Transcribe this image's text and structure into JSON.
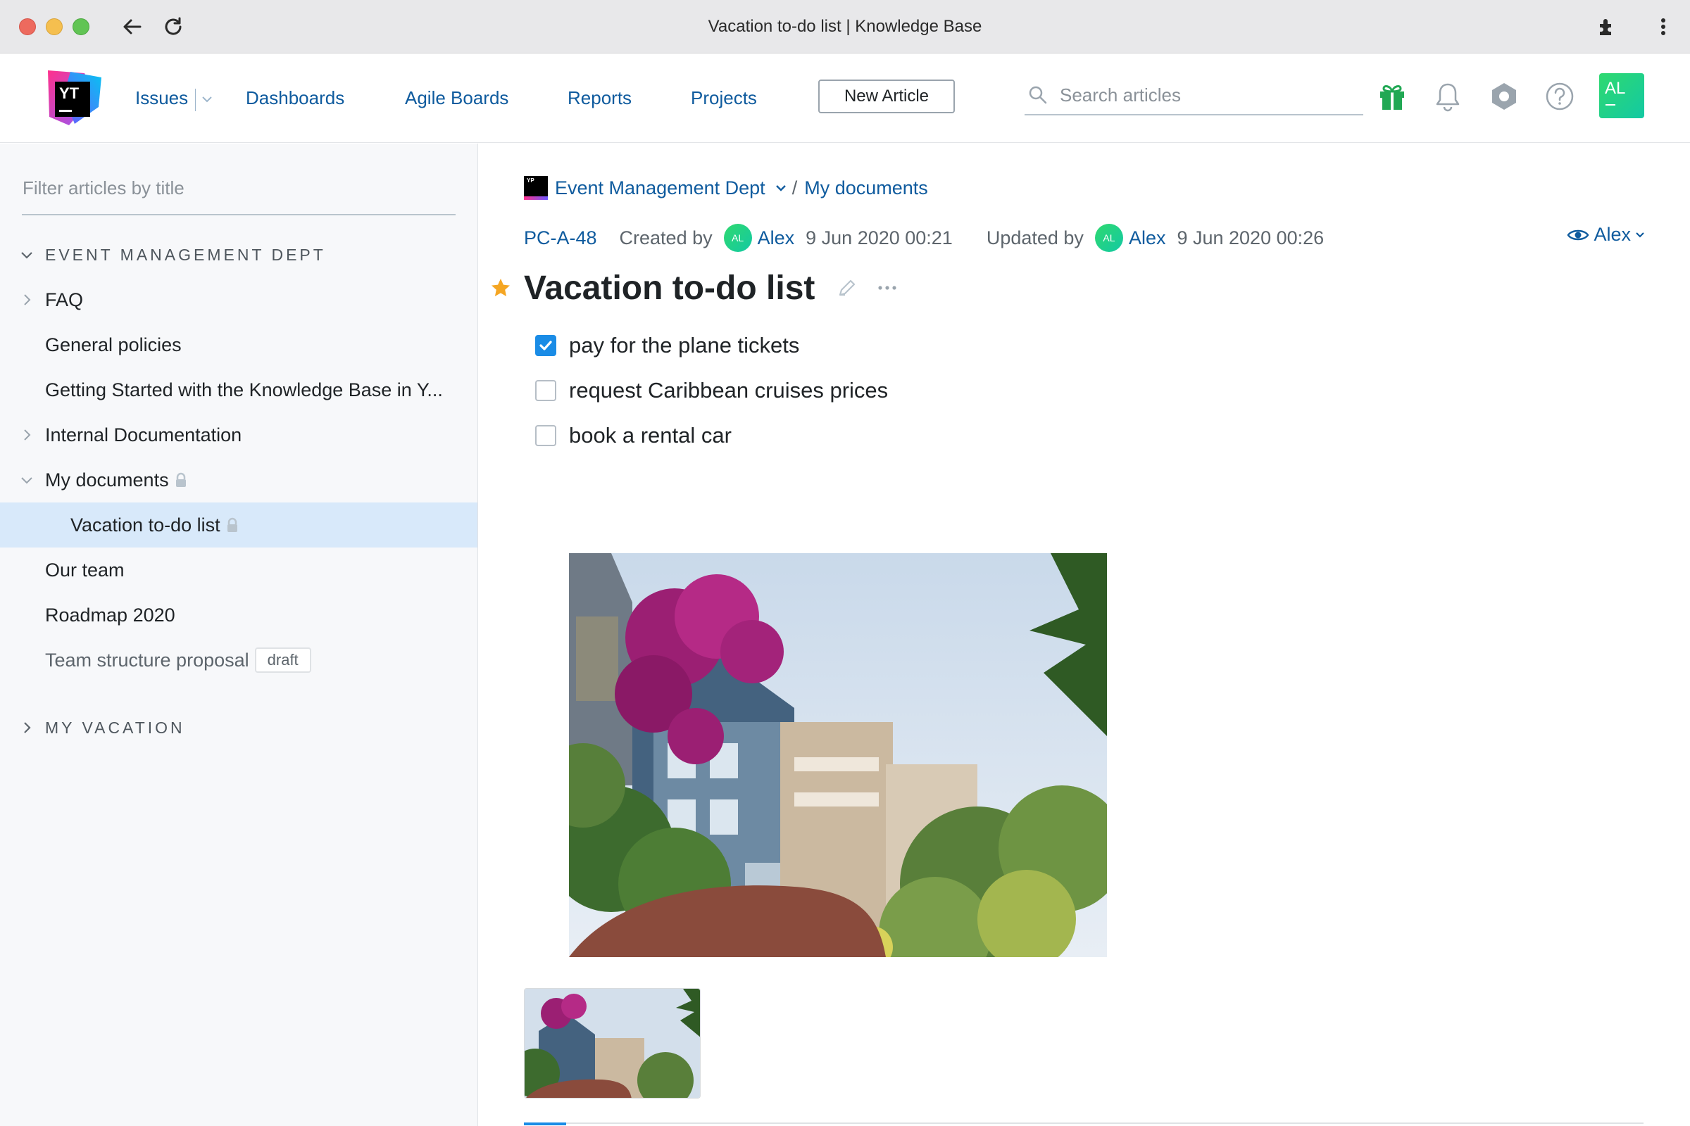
{
  "browser": {
    "tab_title": "Vacation to-do list | Knowledge Base"
  },
  "header": {
    "logo_text": "YT",
    "nav": {
      "issues": "Issues",
      "dashboards": "Dashboards",
      "agile_boards": "Agile Boards",
      "reports": "Reports",
      "projects": "Projects"
    },
    "new_article_label": "New Article",
    "search_placeholder": "Search articles",
    "icons": [
      "gift-icon",
      "bell-icon",
      "settings-icon",
      "help-icon"
    ],
    "avatar_initials": "AL"
  },
  "sidebar": {
    "filter_placeholder": "Filter articles by title",
    "section_1": "EVENT MANAGEMENT DEPT",
    "items": [
      {
        "label": "FAQ"
      },
      {
        "label": "General policies"
      },
      {
        "label": "Getting Started with the Knowledge Base in Y..."
      },
      {
        "label": "Internal Documentation"
      },
      {
        "label": "My documents"
      },
      {
        "label": "Vacation to-do list"
      },
      {
        "label": "Our team"
      },
      {
        "label": "Roadmap 2020"
      },
      {
        "label": "Team structure proposal",
        "badge": "draft"
      }
    ],
    "section_2": "MY VACATION"
  },
  "article": {
    "project_icon_text": "YP",
    "breadcrumb_project": "Event Management Dept",
    "breadcrumb_sep": "/",
    "breadcrumb_parent": "My documents",
    "id": "PC-A-48",
    "created_label": "Created by",
    "created_avatar": "AL",
    "created_author": "Alex",
    "created_date": "9 Jun 2020 00:21",
    "updated_label": "Updated by",
    "updated_avatar": "AL",
    "updated_author": "Alex",
    "updated_date": "9 Jun 2020 00:26",
    "visibility": "Alex",
    "title": "Vacation to-do list",
    "todos": [
      {
        "text": "pay for the plane tickets",
        "checked": true
      },
      {
        "text": "request Caribbean cruises prices",
        "checked": false
      },
      {
        "text": "book a rental car",
        "checked": false
      }
    ]
  },
  "colors": {
    "accent": "#1a8ce6",
    "link": "#0f5b9e",
    "selected_row": "#d8e9fa",
    "star": "#f5a623"
  }
}
